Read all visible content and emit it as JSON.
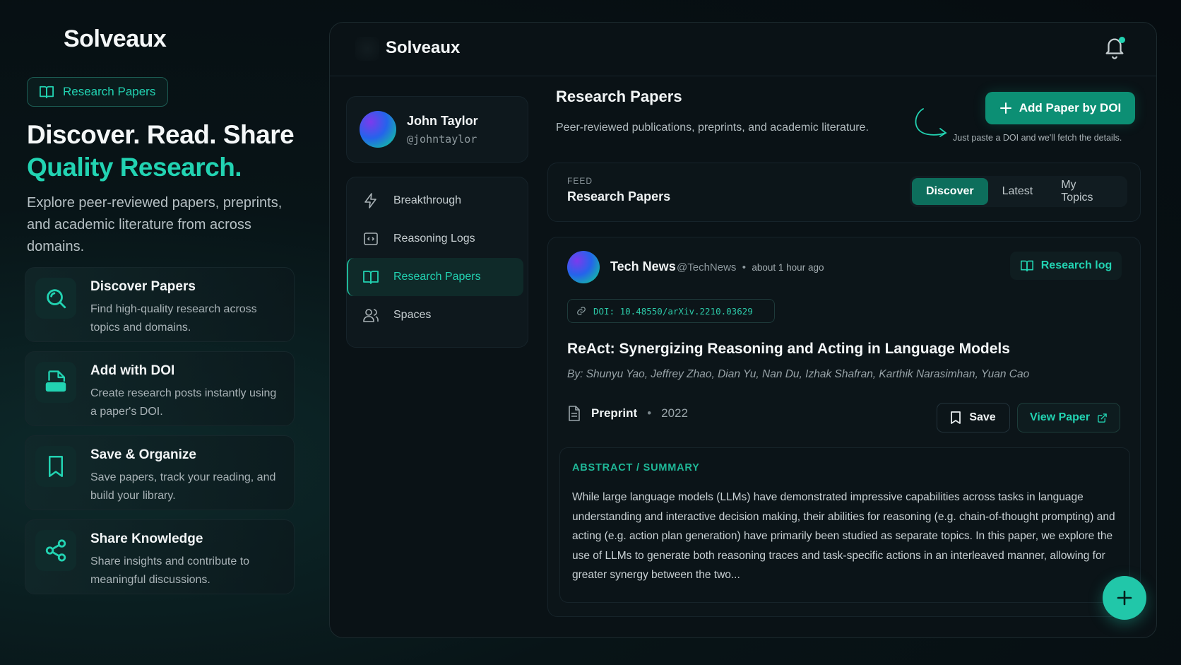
{
  "left": {
    "brand": "Solveaux",
    "pill_label": "Research Papers",
    "hero_line1": "Discover. Read. Share",
    "hero_line2": "Quality Research.",
    "lead": "Explore peer-reviewed papers, preprints, and academic literature from across domains.",
    "features": [
      {
        "title": "Discover Papers",
        "desc": "Find high-quality research across topics and domains.",
        "icon": "search-icon"
      },
      {
        "title": "Add with DOI",
        "desc": "Create research posts instantly using a paper's DOI.",
        "icon": "doi-file-icon"
      },
      {
        "title": "Save & Organize",
        "desc": "Save papers, track your reading, and build your library.",
        "icon": "bookmark-icon"
      },
      {
        "title": "Share Knowledge",
        "desc": "Share insights and contribute to meaningful discussions.",
        "icon": "share-icon"
      }
    ]
  },
  "app": {
    "brand": "Solveaux",
    "profile": {
      "name": "John Taylor",
      "handle": "@johntaylor"
    },
    "nav": [
      {
        "label": "Breakthrough",
        "icon": "lightning-icon"
      },
      {
        "label": "Reasoning Logs",
        "icon": "code-icon"
      },
      {
        "label": "Research Papers",
        "icon": "book-icon",
        "active": true
      },
      {
        "label": "Spaces",
        "icon": "users-icon"
      }
    ],
    "main": {
      "title": "Research Papers",
      "subtitle": "Peer-reviewed publications, preprints, and academic literature.",
      "add_button": "Add Paper by DOI",
      "hint": "Just paste a DOI and we'll fetch the details."
    },
    "feed": {
      "label": "FEED",
      "title": "Research Papers",
      "tabs": [
        "Discover",
        "Latest",
        "My Topics"
      ],
      "active_tab": "Discover"
    },
    "post": {
      "author": "Tech News",
      "handle": "@TechNews",
      "separator": "•",
      "time": "about 1 hour ago",
      "badge": "Research log",
      "doi": "DOI: 10.48550/arXiv.2210.03629",
      "title": "ReAct: Synergizing Reasoning and Acting in Language Models",
      "authors": "By: Shunyu Yao, Jeffrey Zhao, Dian Yu, Nan Du, Izhak Shafran, Karthik Narasimhan, Yuan Cao",
      "type": "Preprint",
      "year": "2022",
      "save_label": "Save",
      "view_label": "View Paper",
      "abstract_heading": "ABSTRACT / SUMMARY",
      "abstract": "While large language models (LLMs) have demonstrated impressive capabilities across tasks in language understanding and interactive decision making, their abilities for reasoning (e.g. chain-of-thought prompting) and acting (e.g. action plan generation) have primarily been studied as separate topics. In this paper, we explore the use of LLMs to generate both reasoning traces and task-specific actions in an interleaved manner, allowing for greater synergy between the two..."
    },
    "fab_label": "+"
  },
  "colors": {
    "accent": "#22d3b2",
    "button": "#0c8f74",
    "background": "#060c10"
  }
}
